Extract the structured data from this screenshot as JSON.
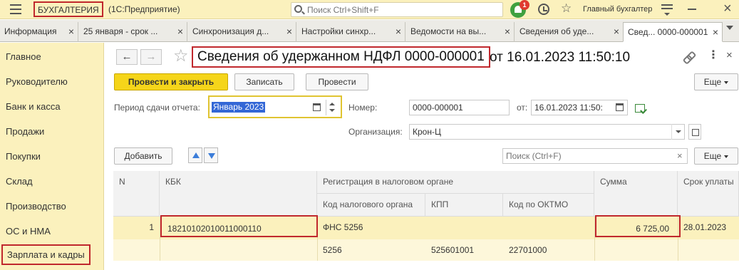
{
  "topbar": {
    "app_name": "БУХГАЛТЕРИЯ",
    "app_sub": "(1С:Предприятие)",
    "search_placeholder": "Поиск Ctrl+Shift+F",
    "notifications_count": "1",
    "user": "Главный бухгалтер"
  },
  "tabs": [
    {
      "label": "Информация"
    },
    {
      "label": "25 января - срок ..."
    },
    {
      "label": "Синхронизация д..."
    },
    {
      "label": "Настройки синхр..."
    },
    {
      "label": "Ведомости на вы..."
    },
    {
      "label": "Сведения об уде..."
    },
    {
      "label": "Свед... 0000-000001"
    }
  ],
  "sidebar": {
    "items": [
      {
        "label": "Главное"
      },
      {
        "label": "Руководителю"
      },
      {
        "label": "Банк и касса"
      },
      {
        "label": "Продажи"
      },
      {
        "label": "Покупки"
      },
      {
        "label": "Склад"
      },
      {
        "label": "Производство"
      },
      {
        "label": "ОС и НМА"
      },
      {
        "label": "Зарплата и кадры"
      }
    ]
  },
  "document": {
    "title_main": "Сведения об удержанном НДФЛ 0000-000001",
    "title_rest": "от 16.01.2023 11:50:10"
  },
  "toolbar": {
    "post_close": "Провести и закрыть",
    "save": "Записать",
    "post": "Провести",
    "more": "Еще"
  },
  "form": {
    "period_label": "Период сдачи отчета:",
    "period_value": "Январь 2023",
    "number_label": "Номер:",
    "number_value": "0000-000001",
    "date_label": "от:",
    "date_value": "16.01.2023 11:50:",
    "org_label": "Организация:",
    "org_value": "Крон-Ц"
  },
  "table_toolbar": {
    "add": "Добавить",
    "search_placeholder": "Поиск (Ctrl+F)",
    "more": "Еще"
  },
  "table": {
    "headers": {
      "n": "N",
      "kbk": "КБК",
      "reg_group": "Регистрация в налоговом органе",
      "tax_code": "Код налогового органа",
      "kpp": "КПП",
      "oktmo": "Код по ОКТМО",
      "sum": "Сумма",
      "due": "Срок уплаты"
    },
    "rows": [
      {
        "n": "1",
        "kbk": "18210102010011000110",
        "reg": "ФНС 5256",
        "tax_code": "5256",
        "kpp": "525601001",
        "oktmo": "22701000",
        "sum": "6 725,00",
        "due": "28.01.2023"
      }
    ]
  }
}
